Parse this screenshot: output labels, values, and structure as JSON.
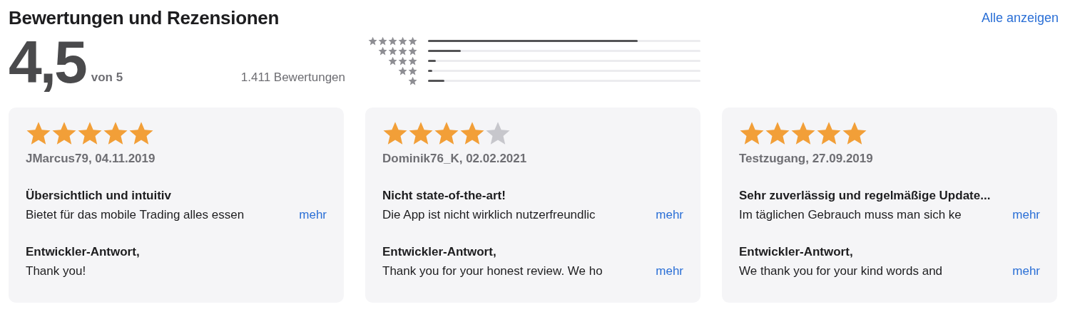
{
  "header": {
    "title": "Bewertungen und Rezensionen",
    "link": "Alle anzeigen"
  },
  "summary": {
    "score": "4,5",
    "out_of": "von 5",
    "count": "1.411 Bewertungen"
  },
  "histogram": [
    {
      "level": 0.77
    },
    {
      "level": 0.12
    },
    {
      "level": 0.03
    },
    {
      "level": 0.015
    },
    {
      "level": 0.06
    }
  ],
  "reviews": [
    {
      "stars": 5,
      "author": "JMarcus79, 04.11.2019",
      "title": "Übersichtlich und intuitiv",
      "body": "Bietet für das mobile Trading alles essen",
      "more": "mehr",
      "reply_label": "Entwickler-Antwort,",
      "reply": "Thank you!"
    },
    {
      "stars": 4,
      "author": "Dominik76_K, 02.02.2021",
      "title": "Nicht state-of-the-art!",
      "body": "Die App ist nicht wirklich nutzerfreundlic",
      "more": "mehr",
      "reply_label": "Entwickler-Antwort,",
      "reply": "Thank you for your honest review. We ho",
      "reply_more": "mehr"
    },
    {
      "stars": 5,
      "author": "Testzugang, 27.09.2019",
      "title": "Sehr zuverlässig und regelmäßige Update...",
      "body": "Im täglichen Gebrauch muss man sich ke",
      "more": "mehr",
      "reply_label": "Entwickler-Antwort,",
      "reply": "We thank you for your kind words and",
      "reply_more": "mehr"
    }
  ]
}
